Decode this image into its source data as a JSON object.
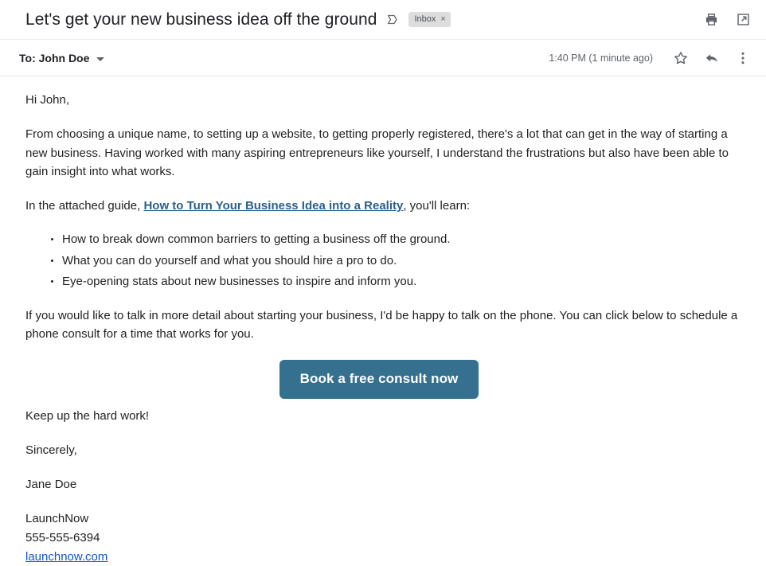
{
  "header": {
    "subject": "Let's get your new business idea off the ground",
    "sent_marker_icon": "sent-chevron-icon",
    "label_chip": "Inbox",
    "label_chip_remove": "×",
    "print_icon": "print-icon",
    "open_in_new_icon": "open-in-new-window-icon"
  },
  "meta": {
    "recipient": "To: John Doe",
    "recipient_caret_icon": "chevron-down-icon",
    "timestamp": "1:40 PM (1 minute ago)",
    "star_icon": "star-icon",
    "reply_icon": "reply-arrow-icon",
    "more_icon": "more-vertical-icon"
  },
  "message": {
    "greeting": "Hi John,",
    "paragraph_1": "From choosing a unique name, to setting up a website, to getting properly registered, there's a lot that can get in the way of starting a new business. Having worked with many aspiring entrepreneurs like yourself, I understand the frustrations but also have been able to gain insight into what works.",
    "guide_intro": "In the attached guide, ",
    "guide_link": "How to Turn Your Business Idea into a Reality",
    "guide_outro": ", you'll learn:",
    "bullets": [
      "How to break down common barriers to getting a business off the ground.",
      "What you can do yourself and what you should hire a pro to do.",
      "Eye-opening stats about new businesses to inspire and inform you."
    ],
    "paragraph_2": "If you would like to talk in more detail about starting your business, I'd be happy to talk on the phone. You can click below to schedule a phone consult for a time that works for you.",
    "cta_label": "Book a free consult now",
    "closing": "Keep up the hard work!",
    "signoff": "Sincerely,",
    "sender_name": "Jane Doe",
    "company": "LaunchNow",
    "phone": "555-555-6394",
    "website": "launchnow.com"
  },
  "colors": {
    "cta_background": "#35708f",
    "guide_link": "#2a5f8a",
    "site_link": "#1155cc",
    "chip_background": "#ddddde"
  }
}
